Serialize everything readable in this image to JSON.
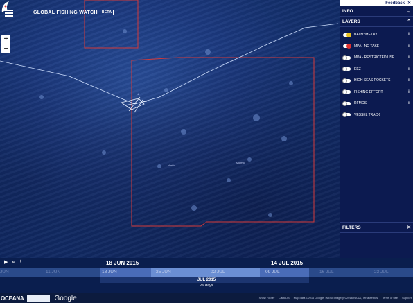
{
  "app": {
    "title": "GLOBAL FISHING WATCH",
    "badge": "BETA",
    "logo": "gfw-fish-logo-icon"
  },
  "map": {
    "zoom_in": "+",
    "zoom_out": "−",
    "place_labels": [
      "N",
      "North",
      "Anomic"
    ]
  },
  "panel": {
    "feedback": "Feedback",
    "info_label": "INFO",
    "layers_label": "LAYERS",
    "filters_label": "FILTERS",
    "layers": [
      {
        "label": "BATHYMETRY",
        "on": true,
        "color": "#e8c020"
      },
      {
        "label": "MPA - NO TAKE",
        "on": true,
        "color": "#e23030"
      },
      {
        "label": "MPA - RESTRICTED USE",
        "on": false,
        "color": "#ffffff"
      },
      {
        "label": "EEZ",
        "on": false,
        "color": "#ffffff"
      },
      {
        "label": "HIGH SEAS POCKETS",
        "on": false,
        "color": "#ffffff"
      },
      {
        "label": "FISHING EFFORT",
        "on": false,
        "color": "#ffffff"
      },
      {
        "label": "RFMOS",
        "on": false,
        "color": "#ffffff"
      },
      {
        "label": "VESSEL TRACK",
        "on": false,
        "color": "#ffffff"
      }
    ]
  },
  "timebar": {
    "start_date": "18 JUN 2015",
    "end_date": "14 JUL 2015",
    "ticks": [
      "JUN",
      "11 JUN",
      "18 JUN",
      "25 JUN",
      "02 JUL",
      "09 JUL",
      "16 JUL",
      "23 JUL"
    ],
    "month": "JUL 2015",
    "span": "26 days"
  },
  "footer": {
    "oceana": "OCEANA",
    "google": "Google",
    "links": [
      "Show Footer",
      "CartoDB",
      "Map data ©2016 Google, INEGI Imagery ©2016 NASA, TerraMetrics",
      "Terms of use",
      "Support"
    ]
  },
  "colors": {
    "mpa_outline": "#d43a3a",
    "vessel_track": "#cfe0ff",
    "panel_bg": "#0c1a50"
  }
}
